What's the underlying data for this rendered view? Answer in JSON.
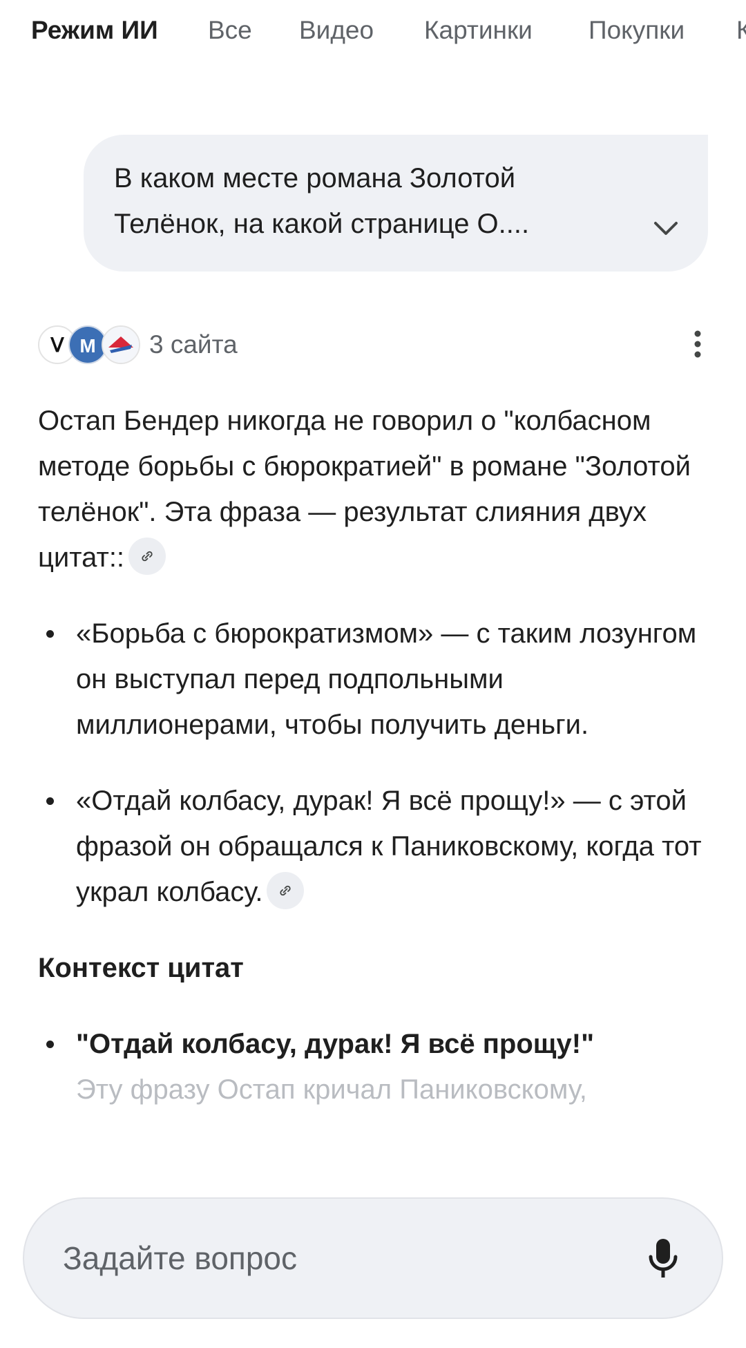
{
  "tabs": [
    {
      "label": "Режим ИИ",
      "active": true
    },
    {
      "label": "Все"
    },
    {
      "label": "Видео"
    },
    {
      "label": "Картинки"
    },
    {
      "label": "Покупки"
    },
    {
      "label": "К"
    }
  ],
  "query": {
    "line1": "В каком месте романа Золотой",
    "line2": "Телёнок, на какой странице О....",
    "expand_icon": "chevron-down-icon"
  },
  "sources": {
    "count_label": "3 сайта",
    "favicons": [
      "v-site-icon",
      "m-site-icon",
      "airplane-logo-icon"
    ],
    "more_icon": "more-vert-icon"
  },
  "answer": {
    "intro": "Остап Бендер никогда не говорил о \"колбасном методе борьбы с бюрократией\" в романе \"Золотой телёнок\". Эта фраза — результат слияния двух цитат::",
    "bullets": [
      "«Борьба с бюрократизмом» — с таким лозунгом он выступал перед подпольными миллионерами, чтобы получить деньги.",
      "«Отдай колбасу, дурак! Я всё прощу!» — с этой фразой он обращался к Паниковскому, когда тот украл колбасу."
    ],
    "context_heading": "Контекст цитат",
    "context_quote": "\"Отдай колбасу, дурак! Я всё прощу!\"",
    "context_text": "Эту фразу Остап кричал Паниковскому,"
  },
  "ask": {
    "placeholder": "Задайте вопрос",
    "mic_icon": "microphone-icon"
  },
  "colors": {
    "bubble": "#eff1f5",
    "text": "#1f1f1f",
    "muted": "#5f6368"
  }
}
